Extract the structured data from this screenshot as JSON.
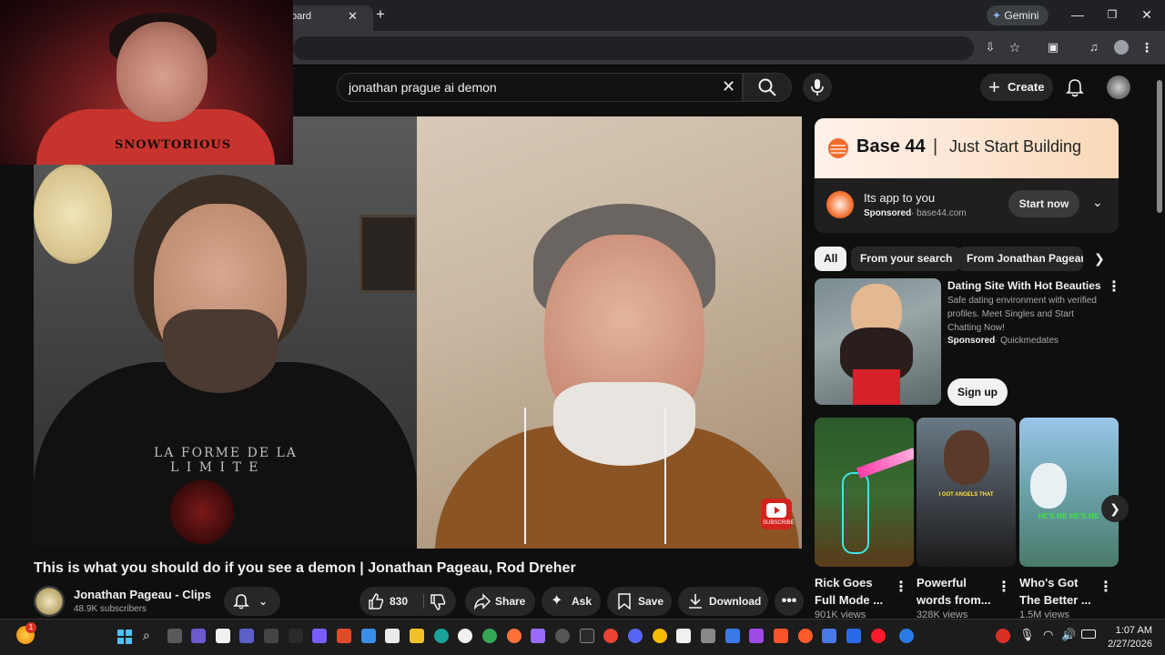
{
  "browser": {
    "tab_label": "oard",
    "gemini_label": "Gemini"
  },
  "header": {
    "search_value": "jonathan prague ai demon",
    "create_label": "Create"
  },
  "webcam": {
    "shirt_text": "SNOWTORIOUS"
  },
  "video": {
    "title": "This is what you should do if you see a demon | Jonathan Pageau, Rod Dreher",
    "shirt_print_line1": "LA FORME DE LA",
    "shirt_print_line2": "L I M I T E",
    "subscribe_badge": "SUBSCRIBE",
    "channel_name": "Jonathan Pageau - Clips",
    "subscribers": "48.9K subscribers",
    "likes": "830",
    "share_label": "Share",
    "ask_label": "Ask",
    "save_label": "Save",
    "download_label": "Download"
  },
  "ad": {
    "brand": "Base 44",
    "separator": "|",
    "tagline": "Just Start Building",
    "headline": "Its app to you",
    "sponsored": "Sponsored",
    "domain": "base44.com",
    "cta": "Start now"
  },
  "chips": [
    "All",
    "From your search",
    "From Jonathan Pageau"
  ],
  "sponsored_card": {
    "title": "Dating Site With Hot Beauties",
    "description": "Safe dating environment with verified profiles. Meet Singles and Start Chatting Now!",
    "sponsored": "Sponsored",
    "advertiser": "Quickmedates",
    "cta": "Sign up"
  },
  "shorts": [
    {
      "title": "Rick Goes Full Mode ...",
      "views": "901K views"
    },
    {
      "title": "Powerful words from...",
      "views": "328K views",
      "caption": "I GOT ANGELS THAT"
    },
    {
      "title": "Who's Got The Better ...",
      "views": "1.5M views",
      "caption": "HE'S ME HE'S ME"
    }
  ],
  "taskbar": {
    "time": "1:07 AM",
    "date": "2/27/2026",
    "badge": "1"
  },
  "colors": {
    "youtube_red": "#ff0000",
    "background": "#0f0f0f",
    "pill": "#272727",
    "base44_orange": "#f26b2b"
  }
}
